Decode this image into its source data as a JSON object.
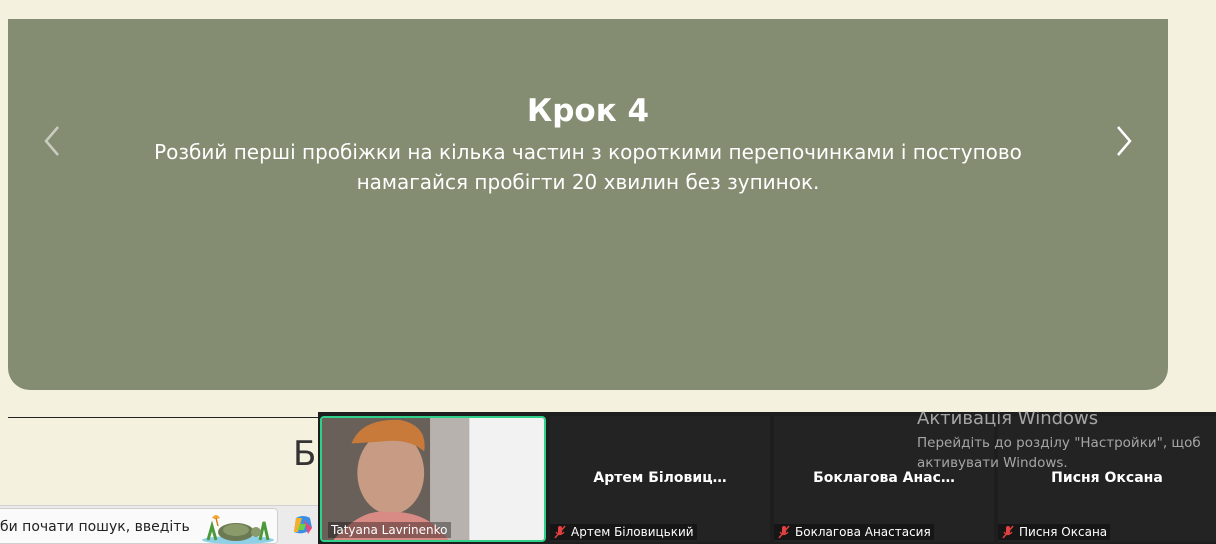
{
  "carousel": {
    "title": "Крок 4",
    "text": "Розбий перші пробіжки на кілька частин з короткими перепочинками і поступово намагайся пробігти 20 хвилин без зупинок.",
    "background": "#848d72"
  },
  "page": {
    "partial_heading": "Б"
  },
  "taskbar": {
    "search_placeholder": "би почати пошук, введіть"
  },
  "meeting": {
    "self_name": "Tatyana Lavrinenko",
    "participants": [
      {
        "display": "Артем Біловиц…",
        "name": "Артем Біловицький",
        "muted": true
      },
      {
        "display": "Боклагова Анас…",
        "name": "Боклагова Анастасия",
        "muted": true
      },
      {
        "display": "Писня Оксана",
        "name": "Писня Оксана",
        "muted": true
      }
    ],
    "active_border_color": "#2fd08a"
  },
  "watermark": {
    "title": "Активація Windows",
    "subtitle": "Перейдіть до розділу \"Настройки\", щоб активувати Windows."
  }
}
